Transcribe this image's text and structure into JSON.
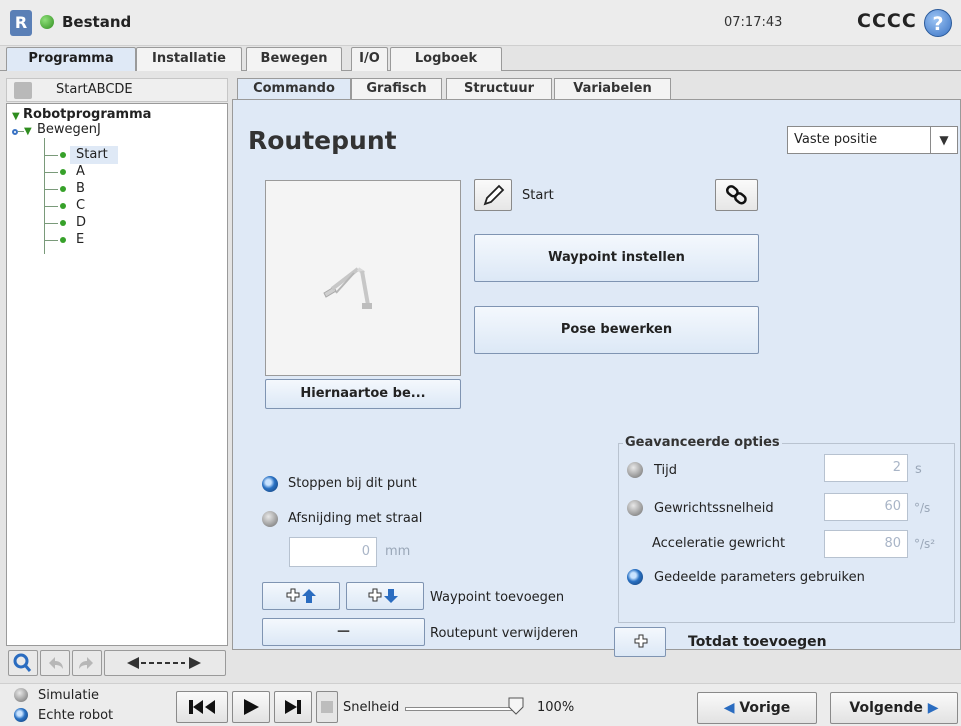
{
  "titlebar": {
    "menu_label": "Bestand",
    "clock": "07:17:43",
    "robot_name": "CCCC",
    "help_glyph": "?",
    "logo_glyph": "R"
  },
  "main_tabs": [
    {
      "label": "Programma",
      "active": true
    },
    {
      "label": "Installatie",
      "active": false
    },
    {
      "label": "Bewegen",
      "active": false
    },
    {
      "label": "I/O",
      "active": false
    },
    {
      "label": "Logboek",
      "active": false
    }
  ],
  "program": {
    "name": "StartABCDE",
    "tree": {
      "root": "Robotprogramma",
      "move": "BewegenJ",
      "waypoints": [
        "Start",
        "A",
        "B",
        "C",
        "D",
        "E"
      ],
      "selected": "Start"
    }
  },
  "sub_tabs": [
    {
      "label": "Commando",
      "active": true
    },
    {
      "label": "Grafisch",
      "active": false
    },
    {
      "label": "Structuur",
      "active": false
    },
    {
      "label": "Variabelen",
      "active": false
    }
  ],
  "command": {
    "heading": "Routepunt",
    "position_type": "Vaste positie",
    "waypoint_name": "Start",
    "set_waypoint_label": "Waypoint instellen",
    "edit_pose_label": "Pose bewerken",
    "move_here_label": "Hiernaartoe be...",
    "stop_label": "Stoppen bij dit punt",
    "blend_label": "Afsnijding met straal",
    "blend_value": "0",
    "blend_unit": "mm",
    "add_waypoint_label": "Waypoint toevoegen",
    "remove_waypoint_label": "Routepunt verwijderen",
    "minus_glyph": "—",
    "add_until_label": "Totdat toevoegen"
  },
  "advanced": {
    "title": "Geavanceerde opties",
    "time_label": "Tijd",
    "time_value": "2",
    "time_unit": "s",
    "joint_speed_label": "Gewrichtssnelheid",
    "joint_speed_value": "60",
    "joint_speed_unit": "°/s",
    "joint_accel_label": "Acceleratie gewricht",
    "joint_accel_value": "80",
    "joint_accel_unit": "°/s²",
    "shared_label": "Gedeelde parameters gebruiken"
  },
  "bottom": {
    "simulation_label": "Simulatie",
    "real_robot_label": "Echte robot",
    "speed_label": "Snelheid",
    "speed_value": "100%",
    "speed_fraction": 1.0,
    "prev_label": "Vorige",
    "next_label": "Volgende"
  },
  "colors": {
    "accent_blue": "#2a6cc0",
    "tree_green": "#37a12a",
    "panel_bg": "#dfe9f6"
  }
}
